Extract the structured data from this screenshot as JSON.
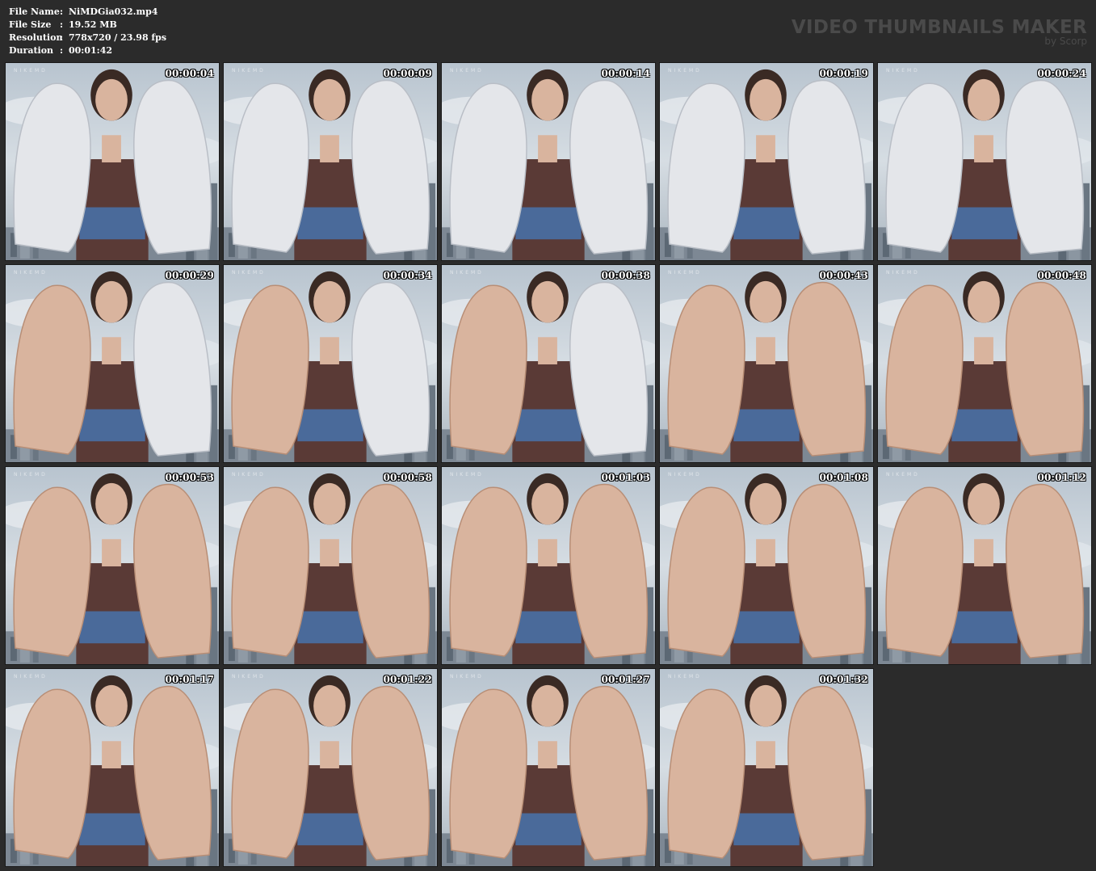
{
  "file_info": {
    "rows": [
      {
        "label": "File Name",
        "sep": ":",
        "value": "NiMDGia032.mp4"
      },
      {
        "label": "File Size",
        "sep": ":",
        "value": "19.52 MB"
      },
      {
        "label": "Resolution",
        "sep": ":",
        "value": "778x720 / 23.98 fps"
      },
      {
        "label": "Duration",
        "sep": ":",
        "value": "00:01:42"
      }
    ]
  },
  "brand": {
    "title": "VIDEO THUMBNAILS MAKER",
    "subtitle": "by Scorp"
  },
  "watermark": "NIKEMD",
  "thumbnails": [
    {
      "time": "00:00:04",
      "scene": "socks"
    },
    {
      "time": "00:00:09",
      "scene": "socks"
    },
    {
      "time": "00:00:14",
      "scene": "socks"
    },
    {
      "time": "00:00:19",
      "scene": "socks"
    },
    {
      "time": "00:00:24",
      "scene": "socks"
    },
    {
      "time": "00:00:29",
      "scene": "mixed"
    },
    {
      "time": "00:00:34",
      "scene": "mixed"
    },
    {
      "time": "00:00:38",
      "scene": "mixed"
    },
    {
      "time": "00:00:43",
      "scene": "bare"
    },
    {
      "time": "00:00:48",
      "scene": "bare"
    },
    {
      "time": "00:00:53",
      "scene": "bare"
    },
    {
      "time": "00:00:58",
      "scene": "bare"
    },
    {
      "time": "00:01:03",
      "scene": "bare"
    },
    {
      "time": "00:01:08",
      "scene": "bare"
    },
    {
      "time": "00:01:12",
      "scene": "bare"
    },
    {
      "time": "00:01:17",
      "scene": "bare"
    },
    {
      "time": "00:01:22",
      "scene": "bare"
    },
    {
      "time": "00:01:27",
      "scene": "bare"
    },
    {
      "time": "00:01:32",
      "scene": "bare"
    }
  ],
  "colors": {
    "background": "#2b2b2b",
    "sky": "#c9d3dc",
    "top": "#5a3a36",
    "skin": "#d9b49e",
    "sock": "#e4e6ea",
    "denim": "#4a6a9a"
  }
}
